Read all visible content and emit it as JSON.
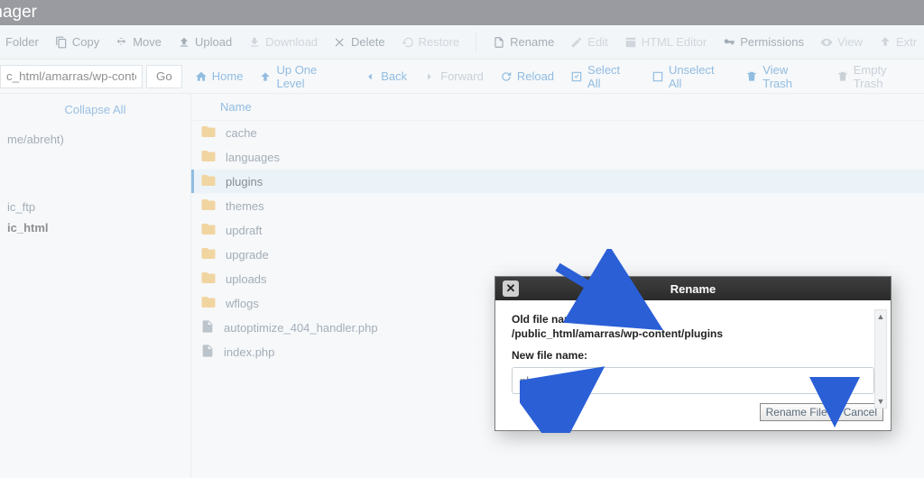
{
  "app_title": "Manager",
  "toolbar": {
    "folder": "Folder",
    "copy": "Copy",
    "move": "Move",
    "upload": "Upload",
    "download": "Download",
    "delete": "Delete",
    "restore": "Restore",
    "rename": "Rename",
    "edit": "Edit",
    "html_editor": "HTML Editor",
    "permissions": "Permissions",
    "view": "View",
    "extract": "Extr"
  },
  "path": {
    "value": "c_html/amarras/wp-conte",
    "go": "Go"
  },
  "nav": {
    "home": "Home",
    "up": "Up One Level",
    "back": "Back",
    "forward": "Forward",
    "reload": "Reload",
    "select_all": "Select All",
    "unselect_all": "Unselect All",
    "view_trash": "View Trash",
    "empty_trash": "Empty Trash"
  },
  "sidebar": {
    "collapse": "Collapse All",
    "root": "me/abreht)",
    "ftp": "ic_ftp",
    "html": "ic_html"
  },
  "table": {
    "name_header": "Name",
    "rows": [
      {
        "type": "folder",
        "name": "cache"
      },
      {
        "type": "folder",
        "name": "languages"
      },
      {
        "type": "folder",
        "name": "plugins",
        "selected": true
      },
      {
        "type": "folder",
        "name": "themes"
      },
      {
        "type": "folder",
        "name": "updraft"
      },
      {
        "type": "folder",
        "name": "upgrade"
      },
      {
        "type": "folder",
        "name": "uploads"
      },
      {
        "type": "folder",
        "name": "wflogs"
      },
      {
        "type": "file",
        "name": "autoptimize_404_handler.php"
      },
      {
        "type": "file",
        "name": "index.php"
      }
    ]
  },
  "dialog": {
    "title": "Rename",
    "old_label": "Old file name:",
    "old_value": "/public_html/amarras/wp-content/plugins",
    "new_label": "New file name:",
    "new_value": "plugins_BK",
    "rename_btn": "Rename File",
    "cancel": "Cancel"
  }
}
